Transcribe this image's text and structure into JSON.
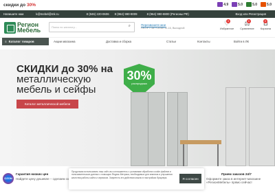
{
  "promo": {
    "text": "скидки до",
    "highlight": "30%"
  },
  "ratings": [
    {
      "value": "4.9",
      "color": "#7b3fb5"
    },
    {
      "value": "5.0",
      "color": "#7b3fb5"
    },
    {
      "value": "5.0",
      "color": "#2e7d32"
    },
    {
      "value": "5.0",
      "color": "#e65100"
    }
  ],
  "infobar": {
    "address": "Напишите нам",
    "email": "k@mebel@mk.ru",
    "phone1": "8 (846) 220-0606",
    "phone2": "8 (964) 990-9009",
    "phone3": "8 (964) 990-8800 (Регионы РФ)",
    "auth": "Вход или Регистрация"
  },
  "logo": {
    "line1": "Регион",
    "line2": "Мебель"
  },
  "search": {
    "placeholder": "Поиск по каталогу..."
  },
  "callback": {
    "link": "Перезвоните мне",
    "hours": "Пн-Пт 7-18 / Сб-Вс 10-16, Выходной"
  },
  "header_icons": [
    {
      "label": "Избранное",
      "count": "0",
      "glyph": "♡"
    },
    {
      "label": "Сравнение",
      "count": "0",
      "glyph": "⚖"
    },
    {
      "label": "Корзина",
      "count": "0",
      "glyph": "🛒"
    }
  ],
  "nav": {
    "catalog": "Каталог товаров",
    "items": [
      "Акции магазина",
      "Доставка и сборка",
      "Статьи",
      "Контакты",
      "Войти в ЛК"
    ]
  },
  "hero": {
    "title_line1": "СКИДКИ до 30% на",
    "title_line2": "металлическую",
    "title_line3": "мебель и сейфы",
    "button": "Каталог металлической мебели",
    "badge_percent": "30%",
    "badge_sub": "распродажа"
  },
  "features": [
    {
      "title": "Гарантия низких цен",
      "sub": "Найдете цену дешевле – сделаем скидку"
    },
    {
      "title": "Прием заказов 24/7",
      "sub": "Оформите заказ в интернет-магазине «РегионМебель» прямо сейчас!"
    }
  ],
  "ozon": {
    "label": "OZON"
  },
  "cookie": {
    "text": "Продолжая использовать наш сайт, вы соглашаетесь с условиями обработки cookie-файлов и пользовательских данных с помощью Яндекс.Метрика, необходимых для анализа и улучшения качества работы сайта и сервисов. Запретить эти действия можно в настройках браузера.",
    "button": "Я согласен"
  }
}
